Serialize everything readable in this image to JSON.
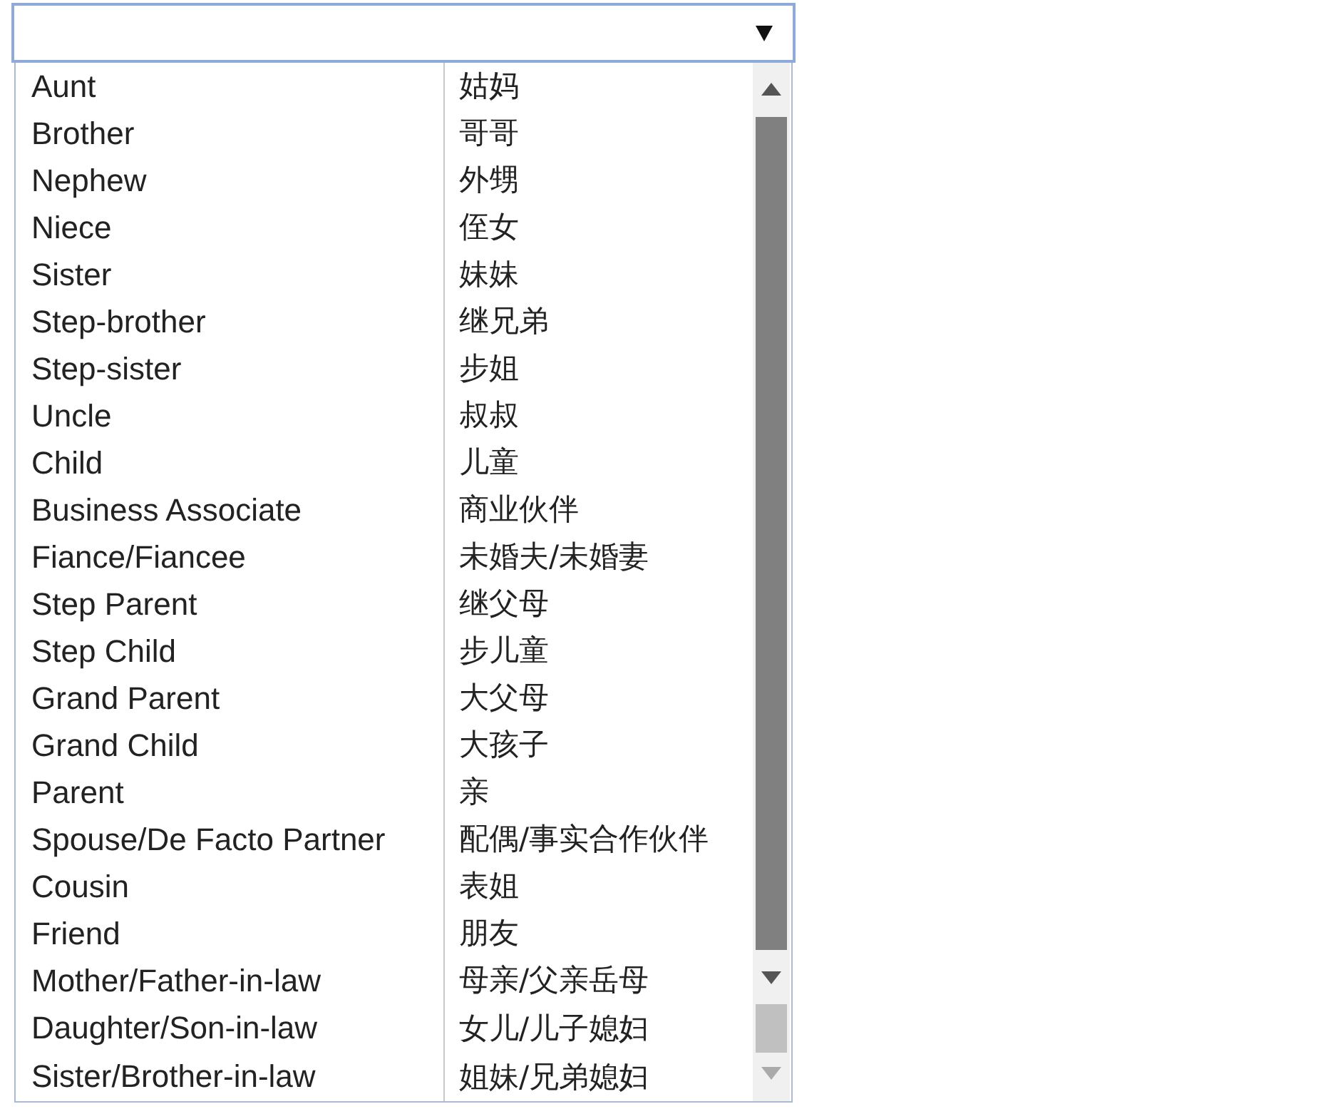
{
  "list": {
    "rows": [
      {
        "en": "Aunt",
        "zh": "姑妈"
      },
      {
        "en": "Brother",
        "zh": "哥哥"
      },
      {
        "en": "Nephew",
        "zh": "外甥"
      },
      {
        "en": "Niece",
        "zh": "侄女"
      },
      {
        "en": "Sister",
        "zh": "妹妹"
      },
      {
        "en": "Step-brother",
        "zh": "继兄弟"
      },
      {
        "en": "Step-sister",
        "zh": "步姐"
      },
      {
        "en": "Uncle",
        "zh": "叔叔"
      },
      {
        "en": "Child",
        "zh": "儿童"
      },
      {
        "en": "Business Associate",
        "zh": "商业伙伴"
      },
      {
        "en": "Fiance/Fiancee",
        "zh": "未婚夫/未婚妻"
      },
      {
        "en": "Step Parent",
        "zh": "继父母"
      },
      {
        "en": "Step Child",
        "zh": "步儿童"
      },
      {
        "en": "Grand Parent",
        "zh": "大父母"
      },
      {
        "en": "Grand Child",
        "zh": "大孩子"
      },
      {
        "en": "Parent",
        "zh": "亲"
      },
      {
        "en": "Spouse/De Facto Partner",
        "zh": "配偶/事实合作伙伴"
      },
      {
        "en": "Cousin",
        "zh": "表姐"
      },
      {
        "en": "Friend",
        "zh": "朋友"
      },
      {
        "en": "Mother/Father-in-law",
        "zh": "母亲/父亲岳母"
      }
    ]
  },
  "lower_list": {
    "rows": [
      {
        "en": "Daughter/Son-in-law",
        "zh": "女儿/儿子媳妇"
      },
      {
        "en": "Sister/Brother-in-law",
        "zh": "姐妹/兄弟媳妇"
      }
    ]
  }
}
